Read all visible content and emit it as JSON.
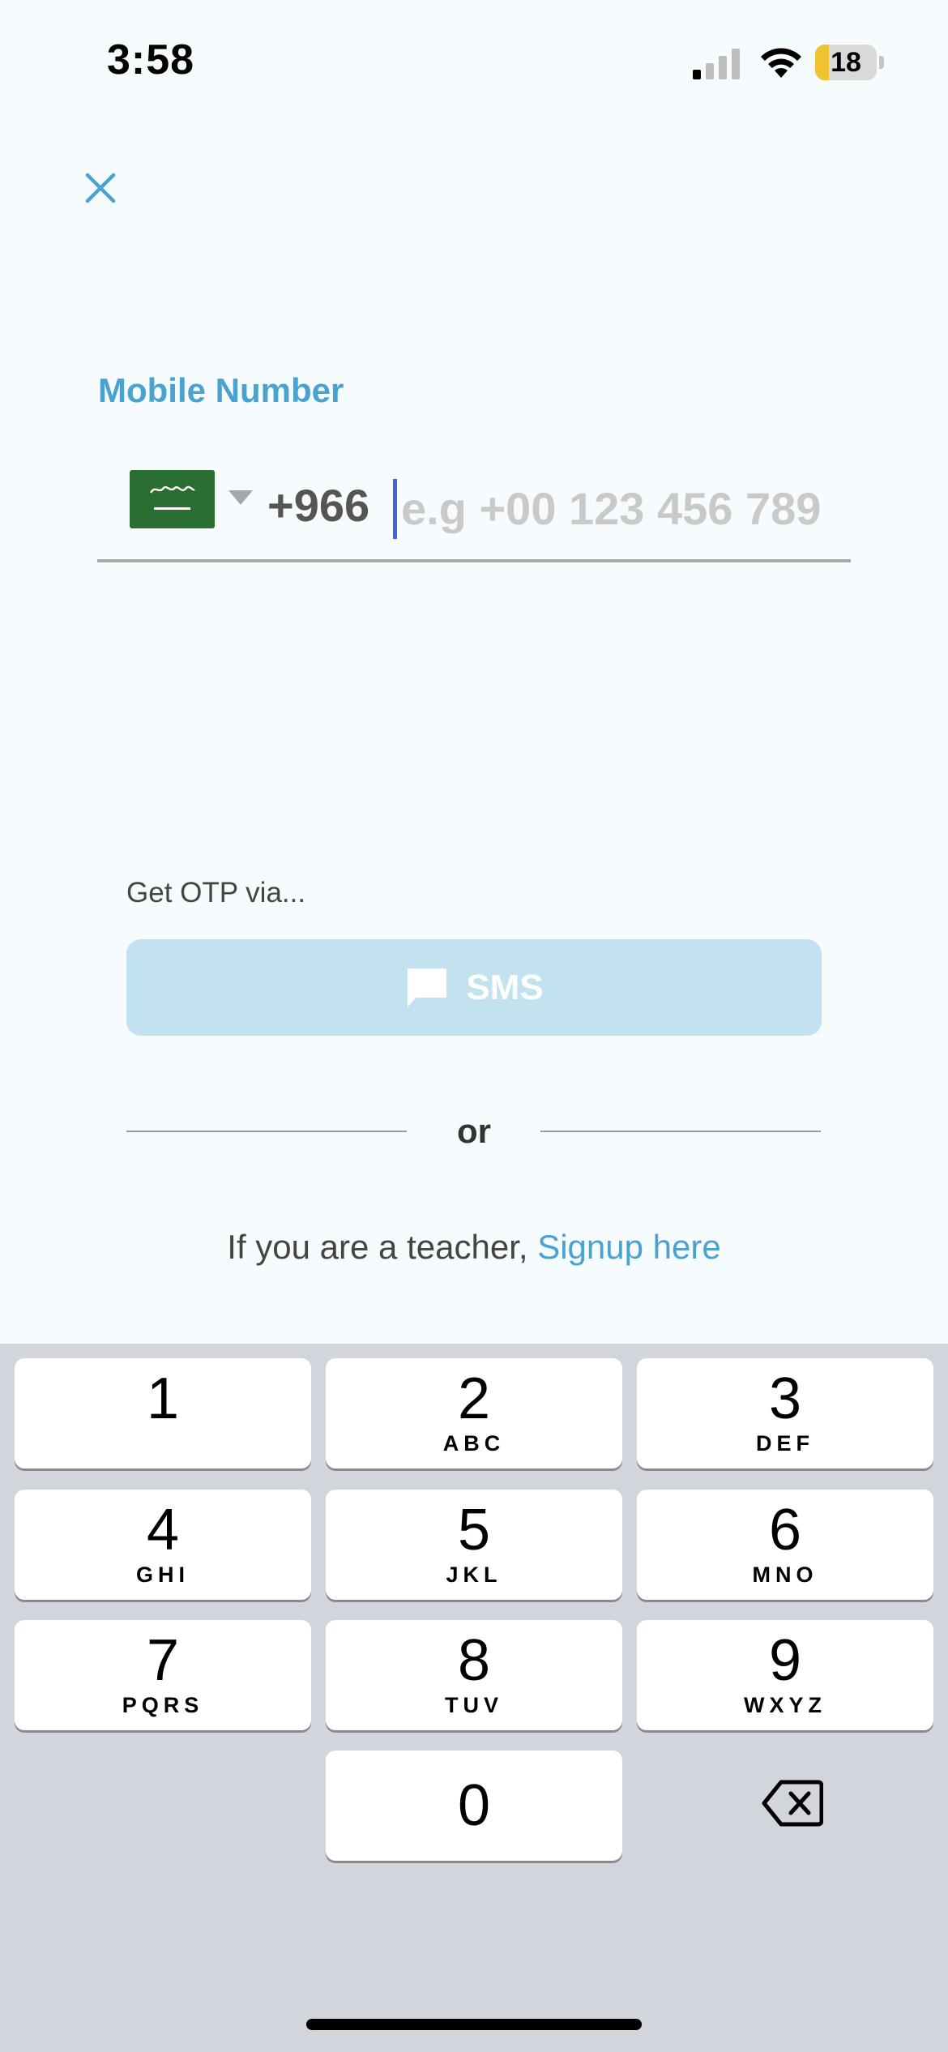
{
  "status_bar": {
    "time": "3:58",
    "battery": "18",
    "icons": [
      "cellular-signal-icon",
      "wifi-icon",
      "battery-icon"
    ]
  },
  "header": {
    "close_icon": "close-icon"
  },
  "form": {
    "label": "Mobile Number",
    "country_flag": "saudi-arabia-flag-icon",
    "dial_code": "+966",
    "placeholder": "e.g +00 123 456 789",
    "value": ""
  },
  "otp": {
    "label": "Get OTP via...",
    "sms_label": "SMS",
    "sms_icon": "chat-bubble-icon"
  },
  "divider": {
    "text": "or"
  },
  "teacher": {
    "prefix": "If you are a teacher, ",
    "link": "Signup here"
  },
  "keypad": {
    "keys": [
      {
        "digit": "1",
        "letters": ""
      },
      {
        "digit": "2",
        "letters": "ABC"
      },
      {
        "digit": "3",
        "letters": "DEF"
      },
      {
        "digit": "4",
        "letters": "GHI"
      },
      {
        "digit": "5",
        "letters": "JKL"
      },
      {
        "digit": "6",
        "letters": "MNO"
      },
      {
        "digit": "7",
        "letters": "PQRS"
      },
      {
        "digit": "8",
        "letters": "TUV"
      },
      {
        "digit": "9",
        "letters": "WXYZ"
      },
      {
        "digit": "0",
        "letters": ""
      }
    ],
    "backspace_icon": "backspace-icon"
  },
  "colors": {
    "accent": "#4aa2d0",
    "sms_button": "#c2e2f0",
    "background": "#f6fbfd",
    "keypad_bg": "#d2d5db",
    "flag_green": "#2a6e32",
    "cursor": "#4a61d6"
  }
}
